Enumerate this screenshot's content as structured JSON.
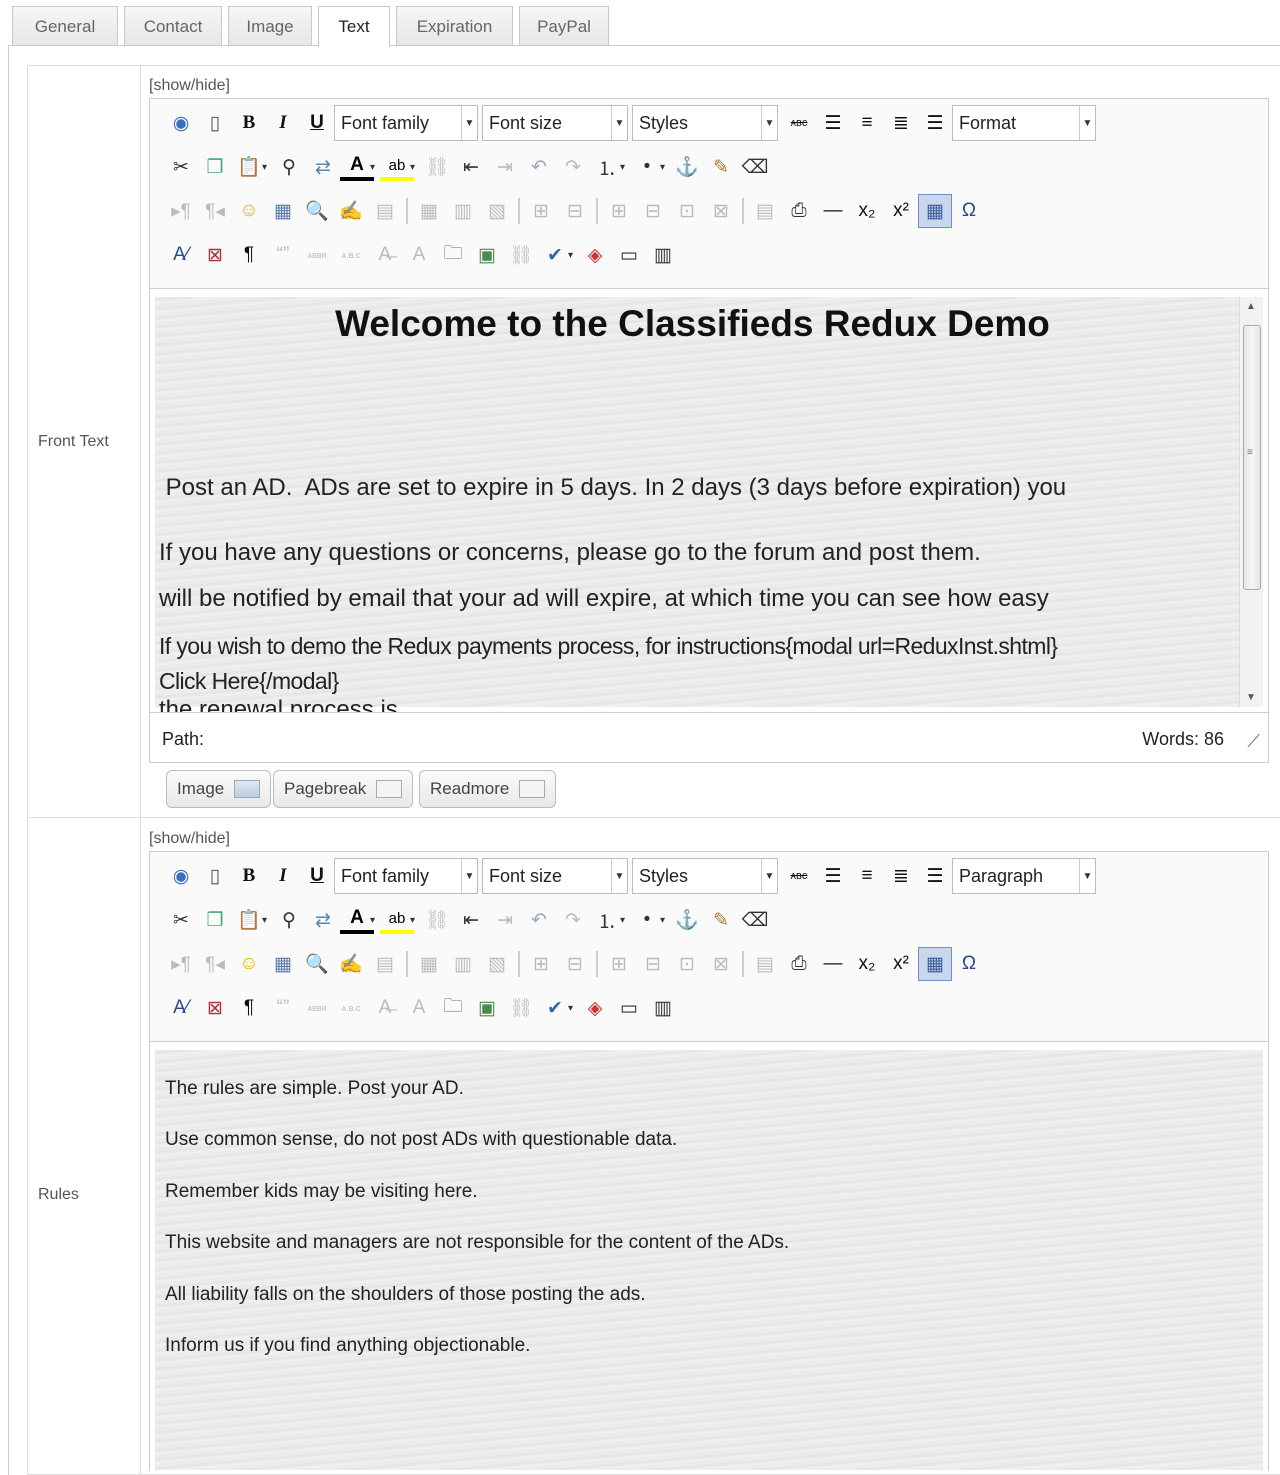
{
  "tabs": [
    "General",
    "Contact",
    "Image",
    "Text",
    "Expiration",
    "PayPal"
  ],
  "active_tab": "Text",
  "show_hide": "[show/hide]",
  "front_text": {
    "label": "Front Text",
    "dropdowns": {
      "font_family": "Font family",
      "font_size": "Font size",
      "styles": "Styles",
      "format": "Format"
    },
    "heading": "Welcome to the Classifieds Redux Demo",
    "p1_lines": [
      " Post an AD.  ADs are set to expire in 5 days. In 2 days (3 days before expiration) you",
      "will be notified by email that your ad will expire, at which time you can see how easy",
      "the renewal process is."
    ],
    "p2": "If you have any questions or concerns, please go to the forum and post them.",
    "p3_lines": [
      "If you wish to demo the Redux payments process, for instructions{modal url=ReduxInst.shtml}",
      "Click Here{/modal}"
    ],
    "path": "Path:",
    "words": "Words: 86"
  },
  "buttons": {
    "image": "Image",
    "pagebreak": "Pagebreak",
    "readmore": "Readmore"
  },
  "rules": {
    "label": "Rules",
    "dropdowns": {
      "font_family": "Font family",
      "font_size": "Font size",
      "styles": "Styles",
      "format": "Paragraph"
    },
    "lines": [
      "The rules are simple. Post your AD.",
      "Use common sense, do not post ADs with questionable data.",
      "Remember kids may be visiting here.",
      "This website and managers are not responsible for the content of the ADs.",
      "All liability falls on the shoulders of those posting the ads.",
      "Inform us if you find anything objectionable."
    ]
  },
  "icons": {
    "row1": [
      "help-icon",
      "new-document-icon",
      "bold-icon",
      "italic-icon",
      "underline-icon",
      "strikethrough-icon",
      "justify-full-icon",
      "align-center-icon",
      "align-left-icon",
      "align-right-icon"
    ],
    "row2": [
      "cut-icon",
      "copy-icon",
      "paste-icon",
      "find-icon",
      "replace-icon",
      "text-color-icon",
      "highlight-color-icon",
      "unlink-icon",
      "outdent-icon",
      "indent-icon",
      "undo-icon",
      "redo-icon",
      "ordered-list-icon",
      "bullet-list-icon",
      "anchor-icon",
      "cleanup-icon",
      "eraser-icon"
    ],
    "row3": [
      "ltr-icon",
      "rtl-icon",
      "emoticon-icon",
      "media-icon",
      "preview-icon",
      "edit-icon",
      "template-icon",
      "table-icon",
      "row-props-icon",
      "cell-props-icon",
      "insert-row-icon",
      "delete-row-icon",
      "insert-col-icon",
      "delete-col-icon",
      "merge-cells-icon",
      "split-cells-icon",
      "layer-icon",
      "print-icon",
      "horizontal-rule-icon",
      "subscript-icon",
      "superscript-icon",
      "visual-aid-icon",
      "special-char-icon"
    ],
    "row4": [
      "styleprops-icon",
      "insert-file-icon",
      "show-blocks-icon",
      "cite-icon",
      "abbr-icon",
      "acronym-icon",
      "del-icon",
      "ins-icon",
      "image-manager-icon",
      "image-icon",
      "link-icon",
      "spellcheck-icon",
      "html-source-icon",
      "fullscreen-icon",
      "attribs-icon"
    ]
  }
}
